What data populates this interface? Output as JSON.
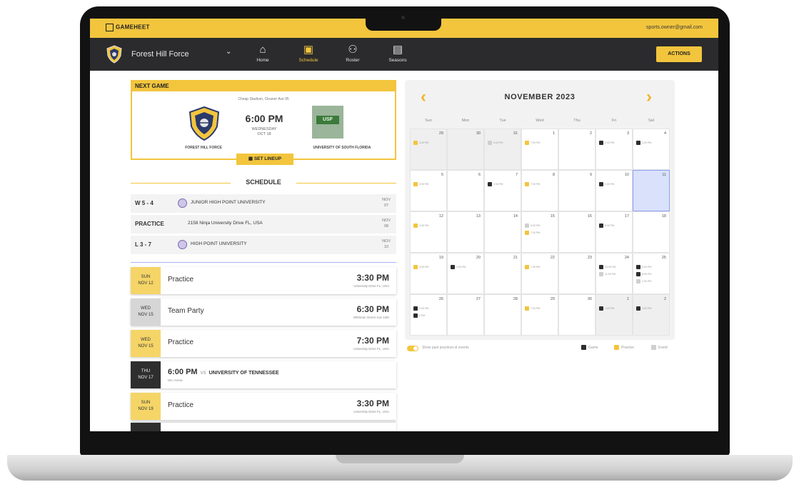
{
  "app": {
    "logo_text": "GAMEHEET",
    "user_email": "sports.owner@gmail.com",
    "team_name": "Forest Hill Force",
    "team_caret": "⌄",
    "nav": [
      {
        "label": "Home",
        "icon": "home-icon",
        "glyph": "⌂"
      },
      {
        "label": "Schedule",
        "icon": "calendar-icon",
        "glyph": "▣"
      },
      {
        "label": "Roster",
        "icon": "roster-icon",
        "glyph": "⚇"
      },
      {
        "label": "Seasons",
        "icon": "seasons-icon",
        "glyph": "▤"
      }
    ],
    "active_nav": "Schedule",
    "actions_label": "ACTIONS",
    "accent_color": "#f2c53d"
  },
  "next_game": {
    "header": "NEXT GAME",
    "venue": "Cheap Stadium, Cleaner Ave 95",
    "time": "6:00 PM",
    "date_line1": "WEDNESDAY",
    "date_line2": "OCT 18",
    "home_team": "FOREST HILL FORCE",
    "away_team": "UNIVERSITY OF SOUTH FLORIDA",
    "away_logo_text": "USF",
    "lineup_label": "SET LINEUP"
  },
  "schedule": {
    "title": "SCHEDULE",
    "recent": [
      {
        "result": "W 5 - 4",
        "text": "JUNIOR HIGH POINT UNIVERSITY",
        "month": "NOV",
        "day": "07",
        "has_logo": true
      },
      {
        "result": "PRACTICE",
        "text": "2158 Ninja University Drive FL, USA",
        "month": "NOV",
        "day": "08",
        "has_logo": false
      },
      {
        "result": "L 3 - 7",
        "text": "HIGH POINT UNIVERSITY",
        "month": "NOV",
        "day": "10",
        "has_logo": true
      }
    ],
    "upcoming": [
      {
        "dow": "SUN",
        "date": "NOV 12",
        "title": "Practice",
        "time": "3:30 PM",
        "location": "University Drive FL, USA",
        "kind": "y"
      },
      {
        "dow": "WED",
        "date": "NOV 15",
        "title": "Team Party",
        "time": "6:30 PM",
        "location": "Whitman Green Ave 12th",
        "kind": "g"
      },
      {
        "dow": "WED",
        "date": "NOV 15",
        "title": "Practice",
        "time": "7:30 PM",
        "location": "University Drive FL, USA",
        "kind": "y"
      },
      {
        "dow": "THU",
        "date": "NOV 17",
        "title": "6:00 PM",
        "vs": "VS",
        "opponent": "UNIVERSITY OF TENNESSEE",
        "sub": "ISC Arena",
        "kind": "k"
      },
      {
        "dow": "SUN",
        "date": "NOV 19",
        "title": "Practice",
        "time": "3:30 PM",
        "location": "University Drive FL, USA",
        "kind": "y"
      }
    ]
  },
  "calendar": {
    "month_title": "NOVEMBER 2023",
    "prev_glyph": "‹",
    "next_glyph": "›",
    "weekdays": [
      "Sun",
      "Mon",
      "Tue",
      "Wed",
      "Thu",
      "Fri",
      "Sat"
    ],
    "today": 11,
    "weeks": [
      [
        {
          "d": "29",
          "o": true,
          "e": [
            [
              "Practice",
              "3:30 PM"
            ]
          ]
        },
        {
          "d": "30",
          "o": true,
          "e": []
        },
        {
          "d": "31",
          "o": true,
          "e": [
            [
              "Event",
              "6:00 PM"
            ]
          ]
        },
        {
          "d": "1",
          "e": [
            [
              "Practice",
              "7:30 PM"
            ]
          ]
        },
        {
          "d": "2",
          "e": []
        },
        {
          "d": "3",
          "e": [
            [
              "Game",
              "1:00 PM"
            ]
          ]
        },
        {
          "d": "4",
          "e": [
            [
              "Game",
              "1:00 PM"
            ]
          ]
        }
      ],
      [
        {
          "d": "5",
          "e": [
            [
              "Practice",
              "3:30 PM"
            ]
          ]
        },
        {
          "d": "6",
          "e": []
        },
        {
          "d": "7",
          "e": [
            [
              "Game",
              "1:00 PM"
            ]
          ]
        },
        {
          "d": "8",
          "e": [
            [
              "Practice",
              "7:30 PM"
            ]
          ]
        },
        {
          "d": "9",
          "e": []
        },
        {
          "d": "10",
          "e": [
            [
              "Game",
              "1:00 PM"
            ]
          ]
        },
        {
          "d": "11",
          "e": []
        }
      ],
      [
        {
          "d": "12",
          "e": [
            [
              "Practice",
              "3:30 PM"
            ]
          ]
        },
        {
          "d": "13",
          "e": []
        },
        {
          "d": "14",
          "e": []
        },
        {
          "d": "15",
          "e": [
            [
              "Event",
              "6:30 PM"
            ],
            [
              "Practice",
              "7:30 PM"
            ]
          ]
        },
        {
          "d": "16",
          "e": []
        },
        {
          "d": "17",
          "e": [
            [
              "Game",
              "6:00 PM"
            ]
          ]
        },
        {
          "d": "18",
          "e": []
        }
      ],
      [
        {
          "d": "19",
          "e": [
            [
              "Practice",
              "3:30 PM"
            ]
          ]
        },
        {
          "d": "20",
          "e": [
            [
              "Game",
              "1:00 PM"
            ]
          ]
        },
        {
          "d": "21",
          "e": []
        },
        {
          "d": "22",
          "e": [
            [
              "Practice",
              "7:30 PM"
            ]
          ]
        },
        {
          "d": "23",
          "e": []
        },
        {
          "d": "24",
          "e": [
            [
              "Game",
              "10:00 PM"
            ],
            [
              "Event",
              "11:00 PM"
            ]
          ]
        },
        {
          "d": "25",
          "e": [
            [
              "Game",
              "1:00 PM"
            ],
            [
              "Game",
              "6:00 PM"
            ],
            [
              "Event",
              "1:00 PM"
            ]
          ]
        }
      ],
      [
        {
          "d": "26",
          "e": [
            [
              "Game",
              "1:00 PM"
            ],
            [
              "Game",
              "1 PM"
            ]
          ]
        },
        {
          "d": "27",
          "e": []
        },
        {
          "d": "28",
          "e": []
        },
        {
          "d": "29",
          "e": [
            [
              "Practice",
              "7:30 PM"
            ]
          ]
        },
        {
          "d": "30",
          "e": []
        },
        {
          "d": "1",
          "o": true,
          "e": [
            [
              "Game",
              "1:00 PM"
            ]
          ]
        },
        {
          "d": "2",
          "o": true,
          "e": [
            [
              "Game",
              "1:00 PM"
            ]
          ]
        }
      ]
    ],
    "toggle_label": "Show past practices & events",
    "legend": [
      {
        "name": "Game",
        "color": "#2e2e2e"
      },
      {
        "name": "Practice",
        "color": "#f2c53d"
      },
      {
        "name": "Event",
        "color": "#cfcfcf"
      }
    ]
  }
}
